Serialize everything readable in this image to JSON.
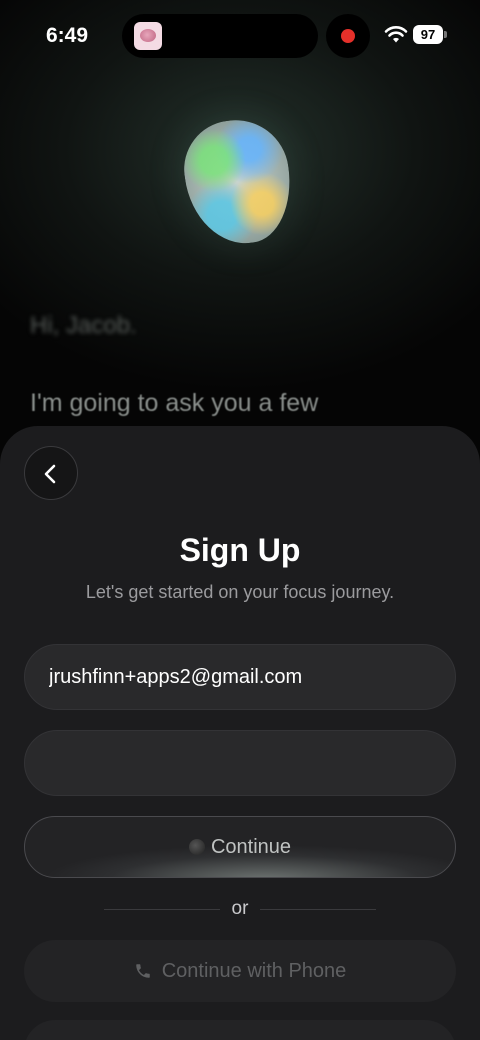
{
  "status_bar": {
    "time": "6:49",
    "battery": "97",
    "recording_color": "#e5302a"
  },
  "background": {
    "greeting": "Hi, Jacob.",
    "message": "I'm going to ask you a few"
  },
  "sheet": {
    "title": "Sign Up",
    "subtitle": "Let's get started on your focus journey.",
    "email_value": "jrushfinn+apps2@gmail.com",
    "password_value": "",
    "continue_label": "Continue",
    "divider_label": "or",
    "phone_label": "Continue with Phone"
  },
  "icons": {
    "back": "chevron-left-icon",
    "phone": "phone-icon",
    "wifi": "wifi-icon"
  }
}
